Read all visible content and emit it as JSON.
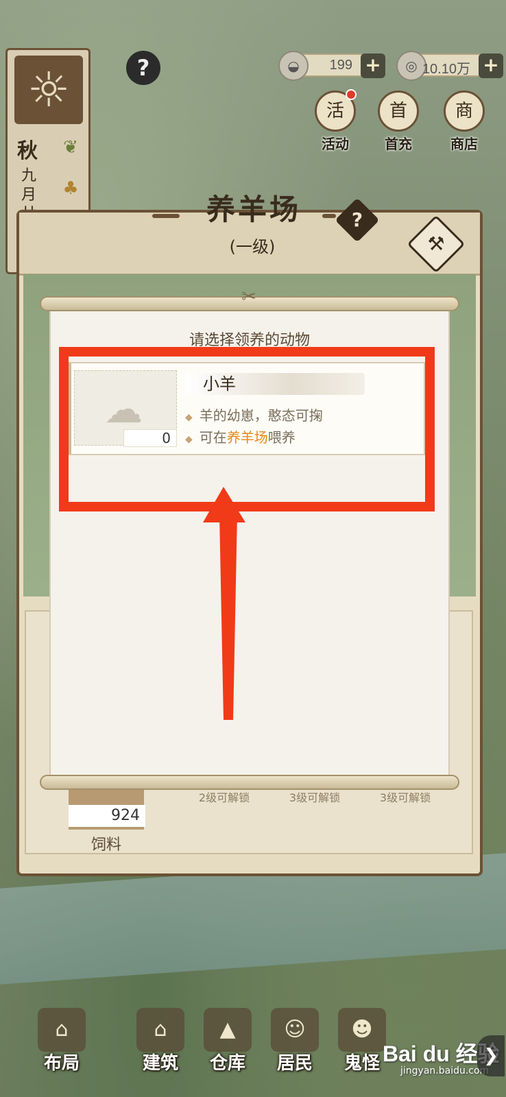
{
  "hud": {
    "season": "秋",
    "month": "九月廿",
    "help_glyph": "?",
    "currency_silver": "199",
    "currency_copper": "10.10万",
    "plus": "+"
  },
  "top_menu": [
    {
      "label": "活动",
      "glyph": "活"
    },
    {
      "label": "首充",
      "glyph": "首"
    },
    {
      "label": "商店",
      "glyph": "商"
    }
  ],
  "building": {
    "title": "养羊场",
    "level": "(一级)",
    "help_glyph": "?",
    "feed_label": "饲料",
    "feed_count": "924",
    "locked_slots": [
      "2级可解锁",
      "3级可解锁",
      "3级可解锁"
    ]
  },
  "popup": {
    "title": "请选择领养的动物",
    "animal": {
      "name": "小羊",
      "count": "0",
      "desc1": "羊的幼崽，憨态可掬",
      "desc2_prefix": "可在",
      "desc2_highlight": "养羊场",
      "desc2_suffix": "喂养"
    }
  },
  "bottom_nav": [
    {
      "label": "布局",
      "glyph": "⌂"
    },
    {
      "label": "建筑",
      "glyph": "⌂"
    },
    {
      "label": "仓库",
      "glyph": "▲"
    },
    {
      "label": "居民",
      "glyph": "☺"
    },
    {
      "label": "鬼怪",
      "glyph": "☻"
    }
  ],
  "watermark": {
    "logo": "Bai du 经验",
    "sub": "jingyan.baidu.com"
  },
  "colors": {
    "annotation": "#f03a18",
    "highlight": "#e8871a",
    "frame": "#6b5236"
  }
}
